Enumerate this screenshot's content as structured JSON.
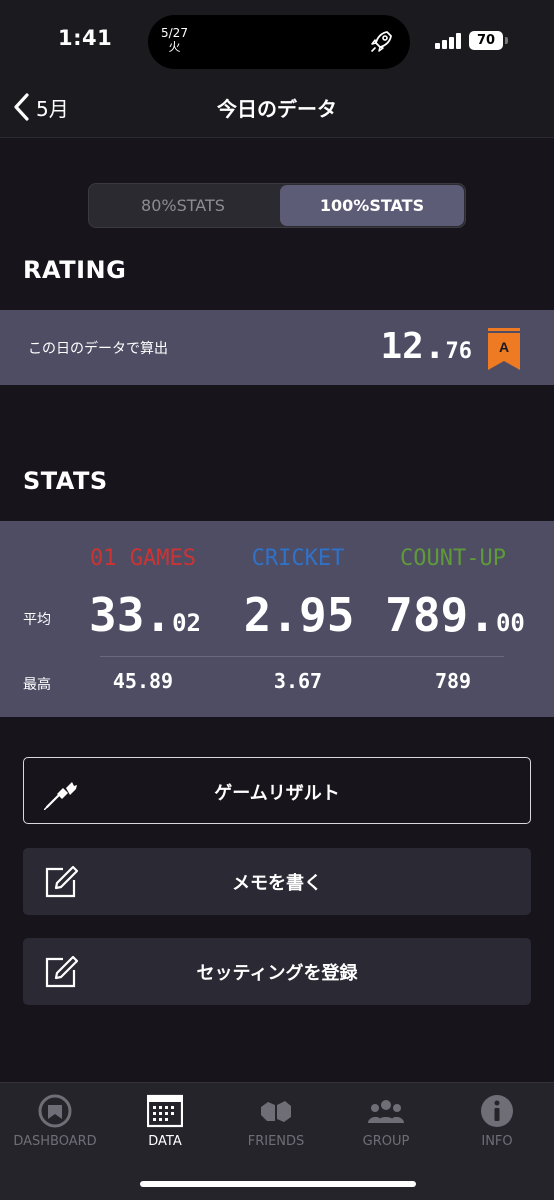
{
  "status_bar": {
    "time": "1:41",
    "island_date": "5/27",
    "island_weekday": "火",
    "battery": "70"
  },
  "nav": {
    "back_label": "5月",
    "title": "今日のデータ"
  },
  "segments": {
    "off_label": "80%STATS",
    "on_label": "100%STATS"
  },
  "rating": {
    "title": "RATING",
    "caption": "この日のデータで算出",
    "value_int": "12.",
    "value_dec": "76",
    "rank": "A",
    "rank_color": "#ee7a22"
  },
  "stats": {
    "title": "STATS",
    "avg_label": "平均",
    "best_label": "最高",
    "columns": [
      {
        "name": "01 GAMES",
        "color": "#cc3434",
        "avg_int": "33.",
        "avg_dec": "02",
        "best": "45.89"
      },
      {
        "name": "CRICKET",
        "color": "#2f72c8",
        "avg_int": "2.95",
        "avg_dec": "",
        "best": "3.67"
      },
      {
        "name": "COUNT-UP",
        "color": "#5e9a3a",
        "avg_int": "789.",
        "avg_dec": "00",
        "best": "789"
      }
    ]
  },
  "actions": [
    {
      "label": "ゲームリザルト",
      "icon": "dart-icon"
    },
    {
      "label": "メモを書く",
      "icon": "edit-icon"
    },
    {
      "label": "セッティングを登録",
      "icon": "edit-icon"
    }
  ],
  "tabs": [
    {
      "label": "DASHBOARD",
      "icon": "dashboard-icon",
      "active": false
    },
    {
      "label": "DATA",
      "icon": "calendar-icon",
      "active": true
    },
    {
      "label": "FRIENDS",
      "icon": "friends-icon",
      "active": false
    },
    {
      "label": "GROUP",
      "icon": "group-icon",
      "active": false
    },
    {
      "label": "INFO",
      "icon": "info-icon",
      "active": false
    }
  ]
}
